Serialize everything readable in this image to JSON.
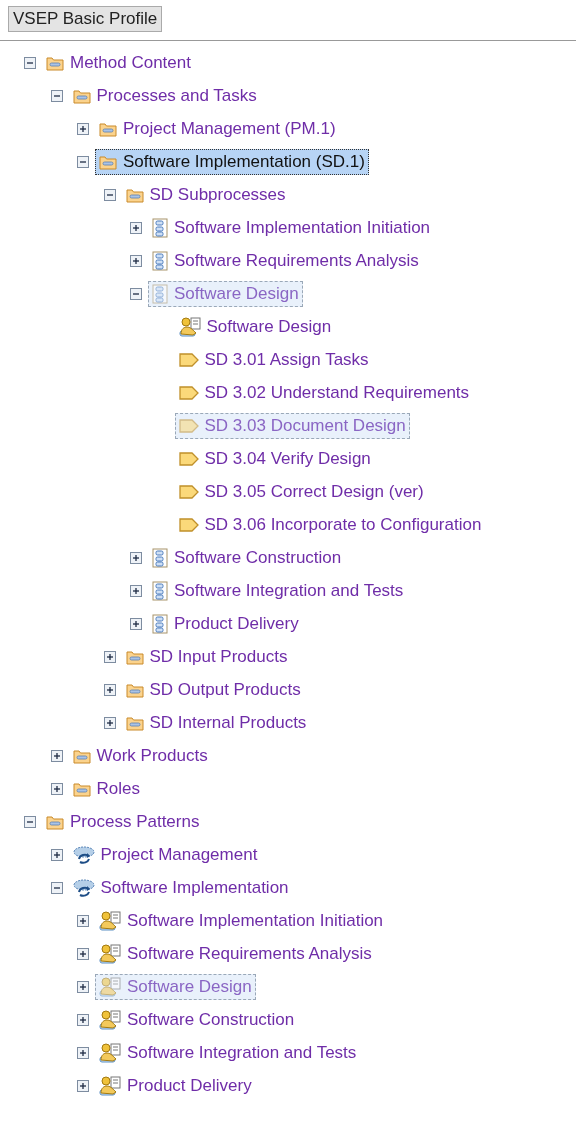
{
  "header": {
    "title": "VSEP Basic Profile"
  },
  "tree": [
    {
      "label": "Method Content",
      "kind": "folder",
      "expanded": true,
      "selected": false,
      "highlighted": false,
      "children": [
        {
          "label": "Processes and Tasks",
          "kind": "folder",
          "expanded": true,
          "selected": false,
          "highlighted": false,
          "children": [
            {
              "label": "Project Management (PM.1)",
              "kind": "folder",
              "expanded": false,
              "selected": false,
              "highlighted": false
            },
            {
              "label": "Software Implementation (SD.1)",
              "kind": "folder",
              "expanded": true,
              "selected": true,
              "highlighted": false,
              "children": [
                {
                  "label": "SD Subprocesses",
                  "kind": "folder",
                  "expanded": true,
                  "selected": false,
                  "highlighted": false,
                  "children": [
                    {
                      "label": "Software Implementation Initiation",
                      "kind": "process",
                      "expanded": false,
                      "selected": false,
                      "highlighted": false
                    },
                    {
                      "label": "Software Requirements Analysis",
                      "kind": "process",
                      "expanded": false,
                      "selected": false,
                      "highlighted": false
                    },
                    {
                      "label": "Software Design",
                      "kind": "process",
                      "expanded": true,
                      "selected": false,
                      "highlighted": true,
                      "children": [
                        {
                          "label": "Software Design",
                          "kind": "activity",
                          "selected": false,
                          "highlighted": false
                        },
                        {
                          "label": "SD 3.01 Assign Tasks",
                          "kind": "task",
                          "selected": false,
                          "highlighted": false
                        },
                        {
                          "label": "SD 3.02 Understand Requirements",
                          "kind": "task",
                          "selected": false,
                          "highlighted": false
                        },
                        {
                          "label": "SD 3.03 Document Design",
                          "kind": "task",
                          "selected": false,
                          "highlighted": true
                        },
                        {
                          "label": "SD 3.04 Verify Design",
                          "kind": "task",
                          "selected": false,
                          "highlighted": false
                        },
                        {
                          "label": "SD 3.05 Correct Design (ver)",
                          "kind": "task",
                          "selected": false,
                          "highlighted": false
                        },
                        {
                          "label": "SD 3.06 Incorporate to Configuration",
                          "kind": "task",
                          "selected": false,
                          "highlighted": false
                        }
                      ]
                    },
                    {
                      "label": "Software Construction",
                      "kind": "process",
                      "expanded": false,
                      "selected": false,
                      "highlighted": false
                    },
                    {
                      "label": "Software Integration and Tests",
                      "kind": "process",
                      "expanded": false,
                      "selected": false,
                      "highlighted": false
                    },
                    {
                      "label": "Product Delivery",
                      "kind": "process",
                      "expanded": false,
                      "selected": false,
                      "highlighted": false
                    }
                  ]
                },
                {
                  "label": "SD Input Products",
                  "kind": "folder",
                  "expanded": false,
                  "selected": false,
                  "highlighted": false
                },
                {
                  "label": "SD Output Products",
                  "kind": "folder",
                  "expanded": false,
                  "selected": false,
                  "highlighted": false
                },
                {
                  "label": "SD Internal Products",
                  "kind": "folder",
                  "expanded": false,
                  "selected": false,
                  "highlighted": false
                }
              ]
            }
          ]
        },
        {
          "label": "Work Products",
          "kind": "folder",
          "expanded": false,
          "selected": false,
          "highlighted": false
        },
        {
          "label": "Roles",
          "kind": "folder",
          "expanded": false,
          "selected": false,
          "highlighted": false
        }
      ]
    },
    {
      "label": "Process Patterns",
      "kind": "folder",
      "expanded": true,
      "selected": false,
      "highlighted": false,
      "children": [
        {
          "label": "Project Management",
          "kind": "pattern",
          "expanded": false,
          "selected": false,
          "highlighted": false
        },
        {
          "label": "Software Implementation",
          "kind": "pattern",
          "expanded": true,
          "selected": false,
          "highlighted": false,
          "children": [
            {
              "label": "Software Implementation Initiation",
              "kind": "activity",
              "expanded": false,
              "selected": false,
              "highlighted": false
            },
            {
              "label": "Software Requirements Analysis",
              "kind": "activity",
              "expanded": false,
              "selected": false,
              "highlighted": false
            },
            {
              "label": "Software Design",
              "kind": "activity",
              "expanded": false,
              "selected": false,
              "highlighted": true
            },
            {
              "label": "Software Construction",
              "kind": "activity",
              "expanded": false,
              "selected": false,
              "highlighted": false
            },
            {
              "label": "Software Integration and Tests",
              "kind": "activity",
              "expanded": false,
              "selected": false,
              "highlighted": false
            },
            {
              "label": "Product Delivery",
              "kind": "activity",
              "expanded": false,
              "selected": false,
              "highlighted": false
            }
          ]
        }
      ]
    }
  ]
}
